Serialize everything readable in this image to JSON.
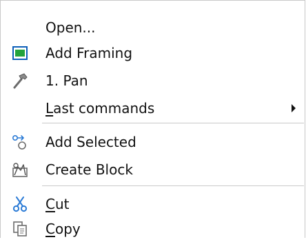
{
  "menu": {
    "items": [
      {
        "label": "Open...",
        "icon": "none"
      },
      {
        "label": "Add Framing",
        "icon": "framing-icon"
      },
      {
        "label": "1. Pan",
        "icon": "hammer-icon"
      },
      {
        "label_mnemonic": "L",
        "label_rest": "ast commands",
        "has_submenu": true,
        "submenu_arrow_icon": "triangle-right-icon"
      },
      {
        "label": "Add Selected",
        "icon": "add-selected-icon"
      },
      {
        "label": "Create Block",
        "icon": "create-block-icon"
      },
      {
        "label_mnemonic": "C",
        "label_rest": "ut",
        "icon": "scissors-icon"
      },
      {
        "label_mnemonic": "C",
        "label_rest": "opy",
        "icon": "copy-icon"
      }
    ]
  },
  "colors": {
    "framing_frame": "#0b5fb8",
    "framing_fill": "#22a33b",
    "scissors": "#2b7bd6",
    "separator": "#c9c9c9"
  }
}
